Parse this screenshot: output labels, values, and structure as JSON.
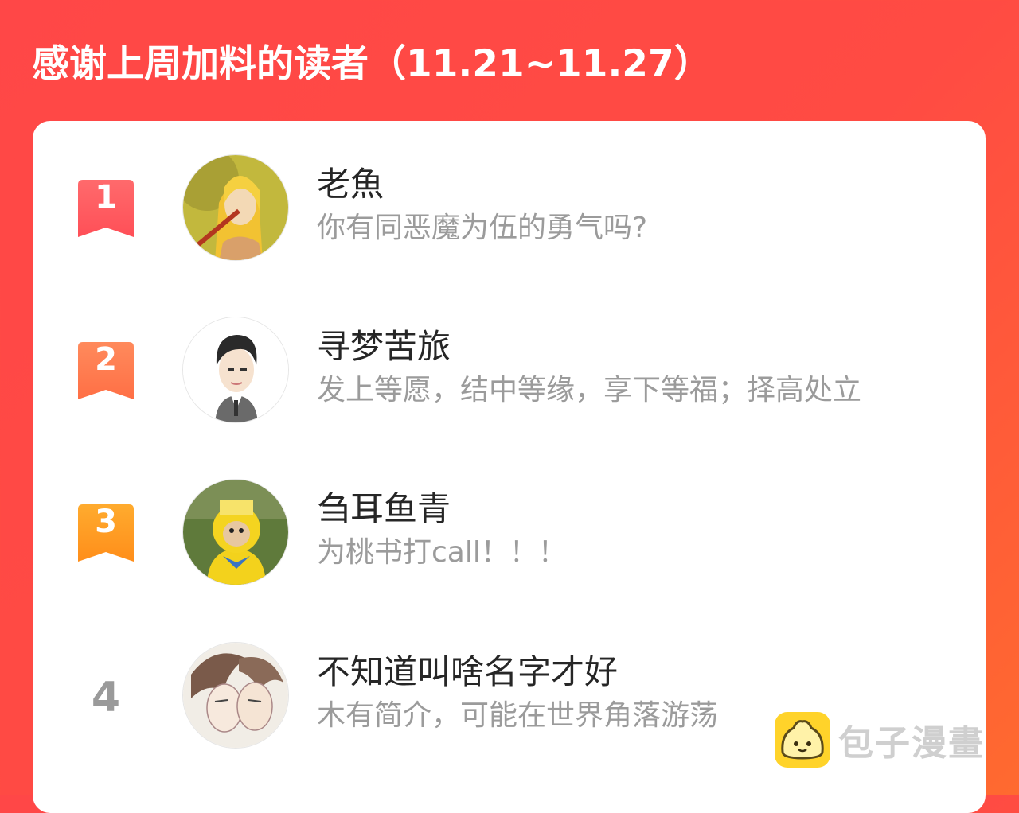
{
  "header": {
    "title": "感谢上周加料的读者（11.21~11.27）"
  },
  "readers": [
    {
      "rank": "1",
      "name": "老魚",
      "desc": "你有同恶魔为伍的勇气吗?",
      "badge_color": "#ff5a5f"
    },
    {
      "rank": "2",
      "name": "寻梦苦旅",
      "desc": "发上等愿，结中等缘，享下等福；择高处立",
      "badge_color": "#ff7a50"
    },
    {
      "rank": "3",
      "name": "刍耳鱼青",
      "desc": "为桃书打call！！！",
      "badge_color": "#ff9a1f"
    },
    {
      "rank": "4",
      "name": "不知道叫啥名字才好",
      "desc": "木有简介，可能在世界角落游荡",
      "badge_color": ""
    }
  ],
  "watermark": {
    "text": "包子漫畫",
    "logo_icon": "bun-face-icon"
  },
  "colors": {
    "background": "#ff4747",
    "card": "#ffffff",
    "name_text": "#262626",
    "desc_text": "#9b9b9b"
  }
}
